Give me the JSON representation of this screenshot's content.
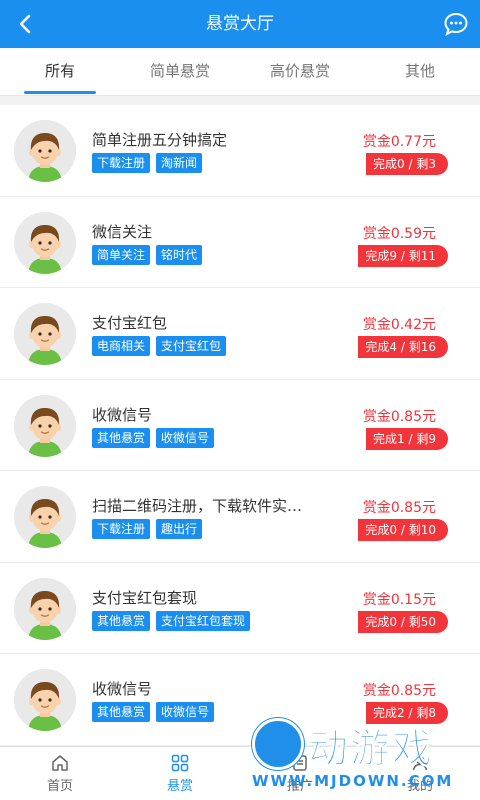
{
  "header": {
    "title": "悬赏大厅",
    "back_icon": "back-icon",
    "chat_icon": "chat-icon"
  },
  "tabs": [
    {
      "label": "所有",
      "active": true
    },
    {
      "label": "简单悬赏",
      "active": false
    },
    {
      "label": "高价悬赏",
      "active": false
    },
    {
      "label": "其他",
      "active": false
    }
  ],
  "tasks": [
    {
      "title": "简单注册五分钟搞定",
      "tags": [
        "下载注册",
        "淘新闻"
      ],
      "reward": "赏金0.77元",
      "progress": "完成0 / 剩3"
    },
    {
      "title": "微信关注",
      "tags": [
        "简单关注",
        "铭时代"
      ],
      "reward": "赏金0.59元",
      "progress": "完成9 / 剩11"
    },
    {
      "title": "支付宝红包",
      "tags": [
        "电商相关",
        "支付宝红包"
      ],
      "reward": "赏金0.42元",
      "progress": "完成4 / 剩16"
    },
    {
      "title": "收微信号",
      "tags": [
        "其他悬赏",
        "收微信号"
      ],
      "reward": "赏金0.85元",
      "progress": "完成1 / 剩9"
    },
    {
      "title": "扫描二维码注册，下载软件实…",
      "tags": [
        "下载注册",
        "趣出行"
      ],
      "reward": "赏金0.85元",
      "progress": "完成0 / 剩10"
    },
    {
      "title": "支付宝红包套现",
      "tags": [
        "其他悬赏",
        "支付宝红包套现"
      ],
      "reward": "赏金0.15元",
      "progress": "完成0 / 剩50"
    },
    {
      "title": "收微信号",
      "tags": [
        "其他悬赏",
        "收微信号"
      ],
      "reward": "赏金0.85元",
      "progress": "完成2 / 剩8"
    }
  ],
  "bottom_nav": [
    {
      "label": "首页",
      "icon": "home-icon",
      "active": false
    },
    {
      "label": "悬赏",
      "icon": "grid-icon",
      "active": true
    },
    {
      "label": "推广",
      "icon": "share-icon",
      "active": false
    },
    {
      "label": "我的",
      "icon": "user-icon",
      "active": false
    }
  ],
  "watermark": {
    "text": "动游戏",
    "url": "WWW.MJDOWN.COM"
  },
  "colors": {
    "primary": "#1a8ff0",
    "danger": "#f2353b"
  }
}
